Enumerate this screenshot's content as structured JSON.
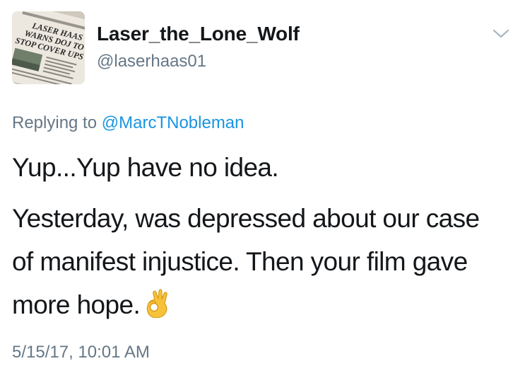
{
  "user": {
    "display_name": "Laser_the_Lone_Wolf",
    "handle": "@laserhaas01",
    "avatar": {
      "icon": "newspaper-avatar",
      "headline": "LASER HAAS WARNS DOJ TO STOP COVER UPS"
    }
  },
  "reply": {
    "prefix": "Replying to",
    "mention": "@MarcTNobleman"
  },
  "tweet": {
    "line1": "Yup...Yup have no idea.",
    "line2": "Yesterday, was depressed about our case of manifest injustice. Then your film gave more hope.",
    "emoji": "ok-hand-emoji"
  },
  "timestamp": "5/15/17, 10:01 AM",
  "menu": {
    "icon": "chevron-down-icon"
  },
  "colors": {
    "text": "#14171a",
    "secondary": "#657786",
    "link": "#1b95e0"
  }
}
